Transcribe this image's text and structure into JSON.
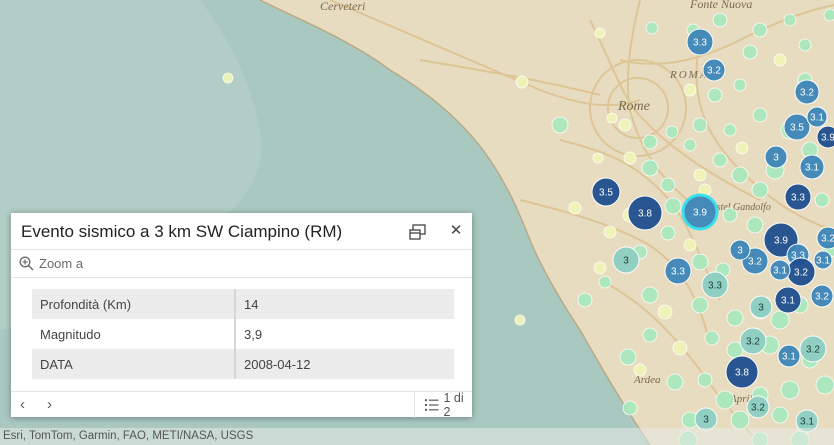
{
  "map": {
    "place_labels": [
      "Cerveteri",
      "Fonte Nuova",
      "ROMA",
      "Rome",
      "Ardea",
      "Aprilia",
      "Castel Gandolfo"
    ],
    "colors": {
      "sea": "#a9c8c0",
      "land": "#e8dcc0",
      "road": "#e2c99a",
      "cluster_dark": "#1f4f8f",
      "cluster_mid": "#3d86b8",
      "cluster_light": "#8ccfc2",
      "point_pale": "#f1f6b8",
      "point_green": "#a8e8bd",
      "selection": "#30e0f0"
    },
    "cluster_labels": [
      "3.3",
      "3.2",
      "3.5",
      "3",
      "3.1",
      "3.3",
      "3.9",
      "3.2",
      "3.1",
      "3.5",
      "3.8",
      "3.9",
      "3.9",
      "3.3",
      "3.2",
      "3.2",
      "3.1",
      "3.3",
      "3",
      "3.2",
      "3.3",
      "3",
      "3.2",
      "3.2",
      "3.1",
      "3.8",
      "3.2",
      "3",
      "3.1",
      "3.2",
      "3.1",
      "3",
      "3.1"
    ]
  },
  "popup": {
    "title": "Evento sismico a 3 km SW Ciampino (RM)",
    "dock_icon": "dock-icon",
    "close_icon": "close-icon",
    "zoom_label": "Zoom a",
    "zoom_icon": "zoom-in-icon",
    "attributes": [
      {
        "key": "Profondità (Km)",
        "value": "14"
      },
      {
        "key": "Magnitudo",
        "value": "3,9"
      },
      {
        "key": "DATA",
        "value": "2008-04-12"
      }
    ],
    "prev_icon": "chevron-left-icon",
    "next_icon": "chevron-right-icon",
    "feature_list_icon": "list-icon",
    "feature_count": "1 di 2"
  },
  "attribution": "Esri, TomTom, Garmin, FAO, METI/NASA, USGS"
}
